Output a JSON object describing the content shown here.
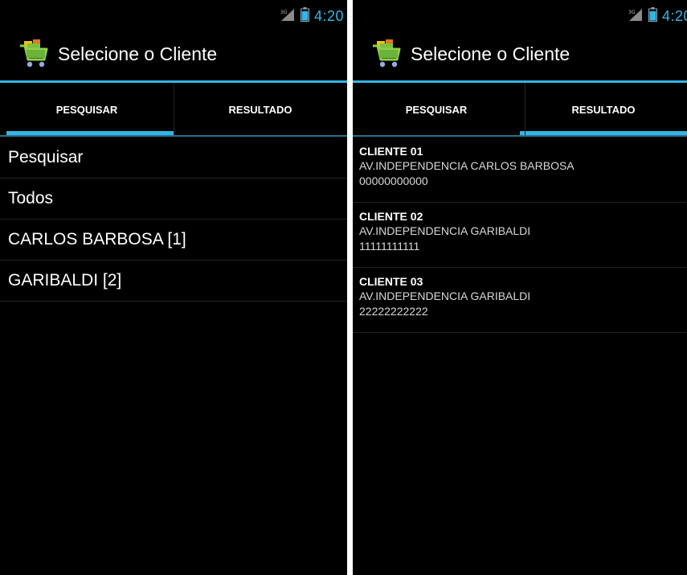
{
  "colors": {
    "accent": "#33b5e5",
    "background": "#000000"
  },
  "left_screen": {
    "status_time": "4:20",
    "title": "Selecione o Cliente",
    "tabs": [
      {
        "label": "PESQUISAR",
        "selected": true
      },
      {
        "label": "RESULTADO",
        "selected": false
      }
    ],
    "items": [
      {
        "label": "Pesquisar"
      },
      {
        "label": "Todos"
      },
      {
        "label": "CARLOS BARBOSA [1]"
      },
      {
        "label": "GARIBALDI [2]"
      }
    ]
  },
  "right_screen": {
    "status_time": "4:20",
    "title": "Selecione o Cliente",
    "tabs": [
      {
        "label": "PESQUISAR",
        "selected": false
      },
      {
        "label": "RESULTADO",
        "selected": true
      }
    ],
    "clients": [
      {
        "name": "CLIENTE 01",
        "address": "AV.INDEPENDENCIA CARLOS BARBOSA",
        "document": "00000000000"
      },
      {
        "name": "CLIENTE 02",
        "address": "AV.INDEPENDENCIA GARIBALDI",
        "document": "11111111111"
      },
      {
        "name": "CLIENTE 03",
        "address": "AV.INDEPENDENCIA GARIBALDI",
        "document": "22222222222"
      }
    ]
  },
  "icons": {
    "app": "shopping-cart-icon",
    "signal": "signal-icon",
    "battery": "battery-icon"
  }
}
